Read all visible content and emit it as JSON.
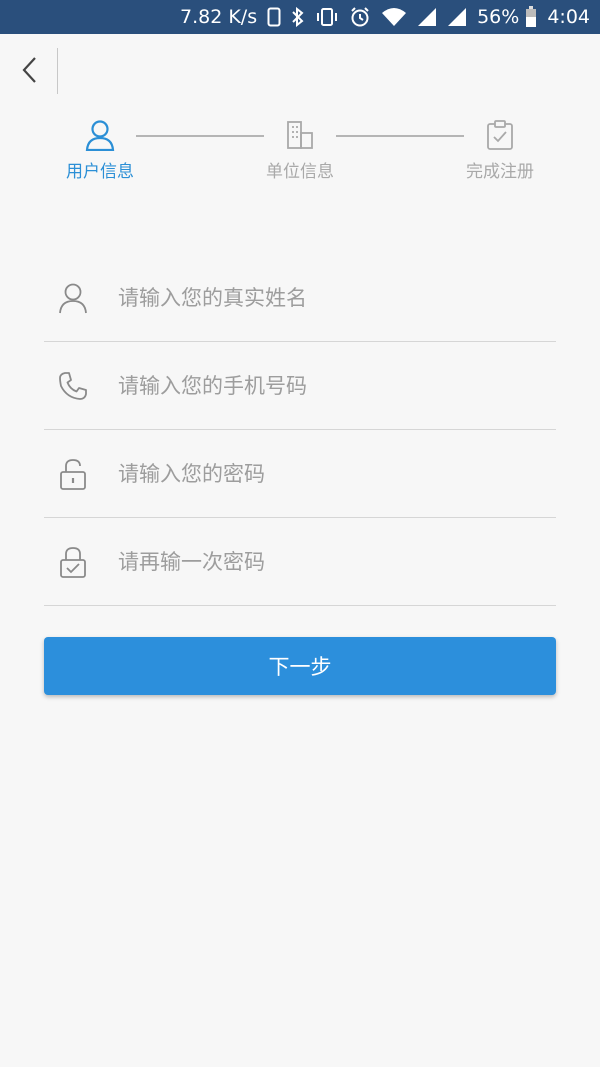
{
  "status_bar": {
    "net_speed": "7.82 K/s",
    "battery_percent": "56%",
    "time": "4:04",
    "icons": [
      "phone-outline-icon",
      "bluetooth-icon",
      "vibrate-icon",
      "alarm-icon",
      "wifi-icon",
      "signal-icon",
      "signal-icon",
      "battery-icon"
    ]
  },
  "steps": [
    {
      "label": "用户信息",
      "icon": "user-icon",
      "active": true
    },
    {
      "label": "单位信息",
      "icon": "building-icon",
      "active": false
    },
    {
      "label": "完成注册",
      "icon": "clipboard-check-icon",
      "active": false
    }
  ],
  "form": {
    "name": {
      "placeholder": "请输入您的真实姓名",
      "value": "",
      "icon": "user-icon"
    },
    "phone": {
      "placeholder": "请输入您的手机号码",
      "value": "",
      "icon": "phone-icon"
    },
    "password": {
      "placeholder": "请输入您的密码",
      "value": "",
      "icon": "lock-open-icon"
    },
    "confirm_password": {
      "placeholder": "请再输一次密码",
      "value": "",
      "icon": "lock-check-icon"
    }
  },
  "next_button": {
    "label": "下一步"
  },
  "colors": {
    "accent": "#2c8fdc",
    "active_step": "#2b8fd6",
    "inactive_step": "#a9a9a9",
    "status_bar": "#2a4f7c",
    "background": "#f7f7f7"
  }
}
